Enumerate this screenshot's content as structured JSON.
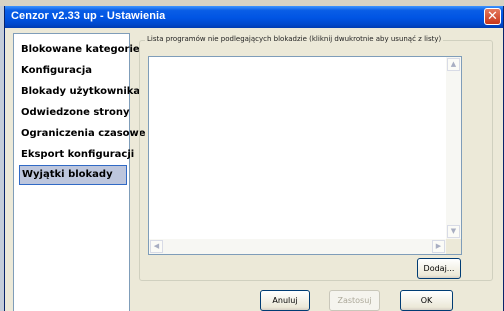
{
  "window": {
    "title": "Cenzor v2.33 up - Ustawienia",
    "close_glyph": "✕"
  },
  "sidebar": {
    "items": [
      {
        "label": "Blokowane kategorie",
        "active": false
      },
      {
        "label": "Konfiguracja",
        "active": false
      },
      {
        "label": "Blokady użytkownika",
        "active": false
      },
      {
        "label": "Odwiedzone strony",
        "active": false
      },
      {
        "label": "Ograniczenia czasowe",
        "active": false
      },
      {
        "label": "Eksport konfiguracji",
        "active": false
      },
      {
        "label": "Wyjątki blokady",
        "active": true
      }
    ]
  },
  "panel": {
    "group_label": "Lista programów nie podlegających blokadzie (kliknij dwukrotnie aby usunąć z listy)",
    "programs": [],
    "add_button": "Dodaj..."
  },
  "footer": {
    "cancel": "Anuluj",
    "apply": "Zastosuj",
    "ok": "OK"
  },
  "colors": {
    "titlebar": "#0054e3",
    "dialog_bg": "#ece9d8",
    "active_item": "#bdc6dd"
  }
}
